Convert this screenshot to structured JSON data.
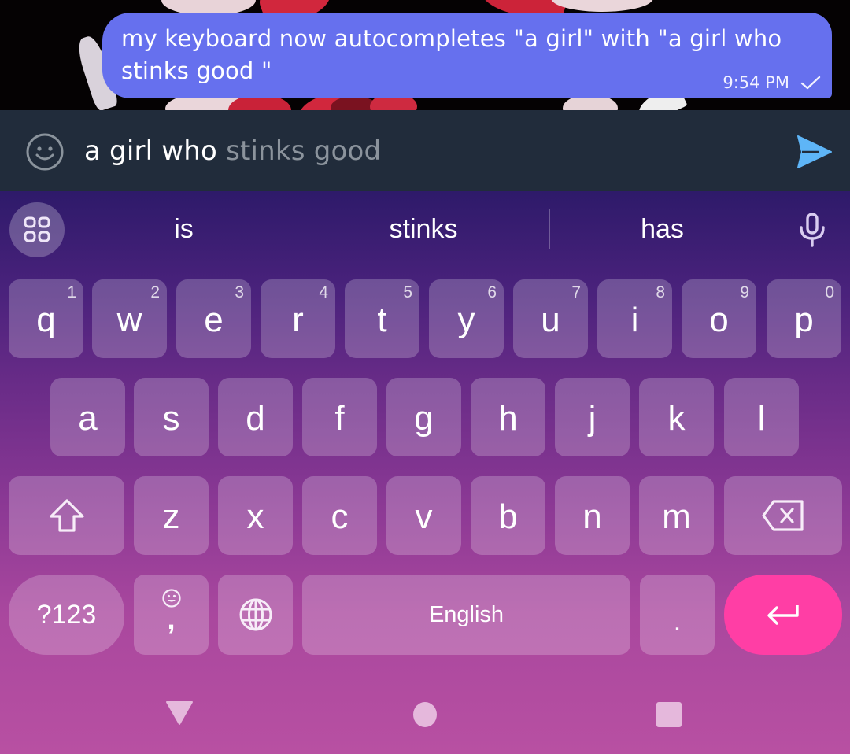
{
  "chat": {
    "message": {
      "text": "my keyboard now autocompletes \"a girl\" with \"a girl who stinks good \"",
      "time": "9:54 PM",
      "status_icon": "single-check-icon"
    },
    "bubble_color": "#6670ee"
  },
  "composer": {
    "typed_text": "a girl who",
    "autocomplete_text": " stinks good",
    "emoji_icon": "smiley-icon",
    "send_icon": "send-icon",
    "send_color": "#5eb5f7",
    "background": "#212c3b"
  },
  "keyboard": {
    "suggestions": [
      "is",
      "stinks",
      "has"
    ],
    "apps_icon": "grid-apps-icon",
    "mic_icon": "microphone-icon",
    "rows": {
      "top": [
        {
          "key": "q",
          "hint": "1"
        },
        {
          "key": "w",
          "hint": "2"
        },
        {
          "key": "e",
          "hint": "3"
        },
        {
          "key": "r",
          "hint": "4"
        },
        {
          "key": "t",
          "hint": "5"
        },
        {
          "key": "y",
          "hint": "6"
        },
        {
          "key": "u",
          "hint": "7"
        },
        {
          "key": "i",
          "hint": "8"
        },
        {
          "key": "o",
          "hint": "9"
        },
        {
          "key": "p",
          "hint": "0"
        }
      ],
      "middle": [
        "a",
        "s",
        "d",
        "f",
        "g",
        "h",
        "j",
        "k",
        "l"
      ],
      "bottom": [
        "z",
        "x",
        "c",
        "v",
        "b",
        "n",
        "m"
      ]
    },
    "shift_icon": "shift-arrow-icon",
    "backspace_icon": "backspace-icon",
    "symbols_label": "?123",
    "comma_label": ",",
    "emoji_key_icon": "emoji-icon",
    "language_icon": "globe-icon",
    "space_label": "English",
    "period_label": ".",
    "enter_icon": "enter-icon",
    "enter_color": "#ff3ea5"
  },
  "navigation": {
    "back_icon": "triangle-back-icon",
    "home_icon": "circle-home-icon",
    "recents_icon": "square-recents-icon"
  }
}
